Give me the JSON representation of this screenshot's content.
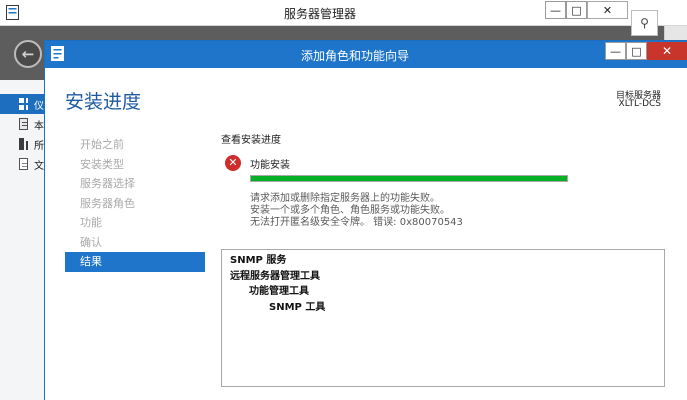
{
  "background_window": {
    "title": "服务器管理器",
    "controls": {
      "minimize": "—",
      "maximize": "□",
      "close": "✕"
    },
    "back_glyph": "←",
    "search_glyph": "⚲",
    "sidebar": [
      {
        "icon": "dashboard-icon",
        "label": "仪"
      },
      {
        "icon": "local-server-icon",
        "label": "本"
      },
      {
        "icon": "all-servers-icon",
        "label": "所"
      },
      {
        "icon": "file-services-icon",
        "label": "文"
      }
    ]
  },
  "wizard": {
    "title": "添加角色和功能向导",
    "controls": {
      "minimize": "—",
      "maximize": "□",
      "close": "✕"
    },
    "page_title": "安装进度",
    "target_server_label": "目标服务器",
    "target_server_name": "XLTL-DCS",
    "steps": [
      {
        "label": "开始之前",
        "active": false
      },
      {
        "label": "安装类型",
        "active": false
      },
      {
        "label": "服务器选择",
        "active": false
      },
      {
        "label": "服务器角色",
        "active": false
      },
      {
        "label": "功能",
        "active": false
      },
      {
        "label": "确认",
        "active": false
      },
      {
        "label": "结果",
        "active": true
      }
    ],
    "content": {
      "heading": "查看安装进度",
      "status_icon": "error-icon",
      "status_glyph": "✕",
      "status_title": "功能安装",
      "progress": 1.0,
      "messages": [
        "请求添加或删除指定服务器上的功能失败。",
        "安装一个或多个角色、角色服务或功能失败。",
        "无法打开匿名级安全令牌。 错误: 0x80070543"
      ],
      "results": [
        {
          "text": "SNMP 服务",
          "level": 0
        },
        {
          "text": "远程服务器管理工具",
          "level": 1
        },
        {
          "text": "功能管理工具",
          "level": 2
        },
        {
          "text": "SNMP 工具",
          "level": 3
        }
      ]
    },
    "colors": {
      "accent": "#1e75c9",
      "error": "#cf2d2d",
      "progress": "#06b025",
      "step_disabled": "#a9a9a9"
    }
  }
}
